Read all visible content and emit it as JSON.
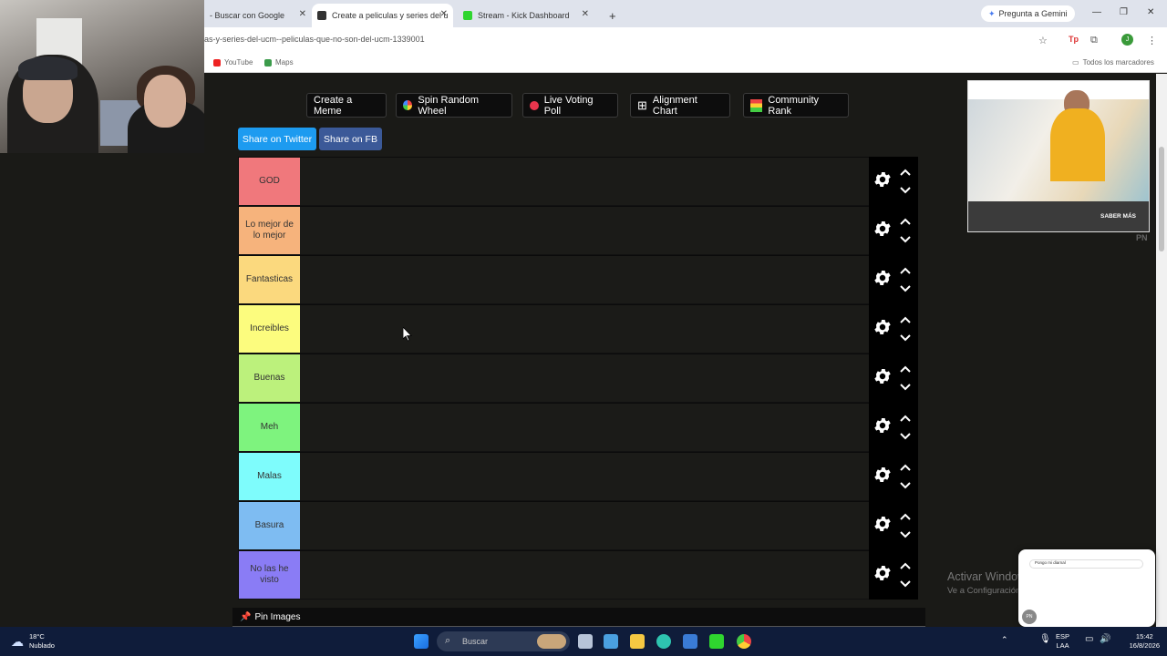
{
  "browser": {
    "tabs": [
      {
        "label": "- Buscar con Google",
        "active": false
      },
      {
        "label": "Create a peliculas y series del u",
        "active": true
      },
      {
        "label": "Stream - Kick Dashboard",
        "active": false
      }
    ],
    "gemini_label": "Pregunta a Gemini",
    "url": "as-y-series-del-ucm--peliculas-que-no-son-del-ucm-1339001",
    "bookmarks": [
      "YouTube",
      "Maps"
    ],
    "all_bookmarks_label": "Todos los marcadores"
  },
  "toolbar": {
    "buttons": [
      "Create a Meme",
      "Spin Random Wheel",
      "Live Voting Poll",
      "Alignment Chart",
      "Community Rank"
    ],
    "share_twitter": "Share on Twitter",
    "share_fb": "Share on FB"
  },
  "tiers": [
    {
      "label": "GOD",
      "color": "#f0787c"
    },
    {
      "label": "Lo mejor de lo mejor",
      "color": "#f6b37c"
    },
    {
      "label": "Fantasticas",
      "color": "#fbd97e"
    },
    {
      "label": "Increibles",
      "color": "#fcfc7e"
    },
    {
      "label": "Buenas",
      "color": "#bcf17c"
    },
    {
      "label": "Meh",
      "color": "#7ef37e"
    },
    {
      "label": "Malas",
      "color": "#7efcfc"
    },
    {
      "label": "Basura",
      "color": "#7ebcf2"
    },
    {
      "label": "No las he visto",
      "color": "#8a7cf5"
    }
  ],
  "ad": {
    "cta": "SABER MÁS",
    "tag": "PN"
  },
  "pin_images": "Pin Images",
  "watermark": {
    "title": "Activar Windows",
    "subtitle": "Ve a Configuración para activar Windows."
  },
  "popup": {
    "search_text": "Pongo mi diarnal"
  },
  "taskbar": {
    "weather_temp": "18°C",
    "weather_desc": "Nublado",
    "search_placeholder": "Buscar",
    "lang_1": "ESP",
    "lang_2": "LAA",
    "time": "15:42",
    "date": "16/8/2026"
  }
}
